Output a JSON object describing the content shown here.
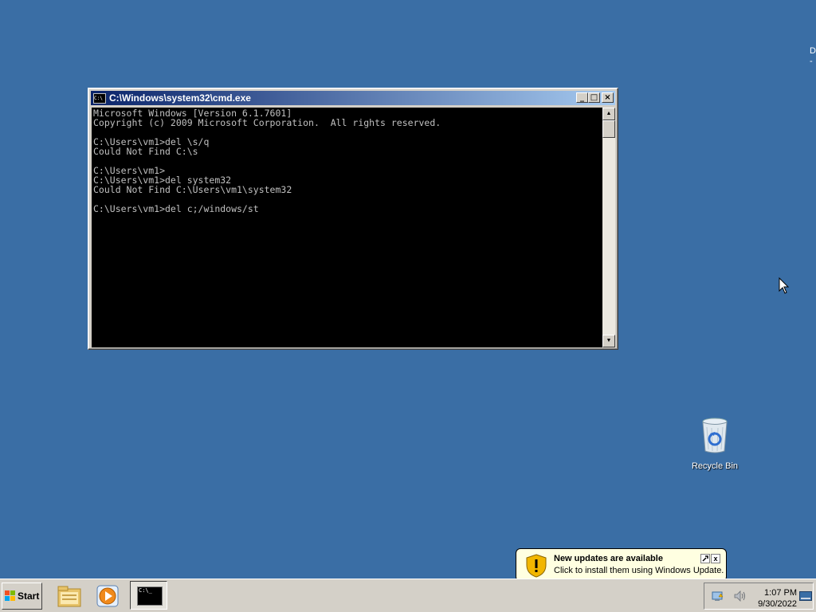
{
  "desktop": {
    "edge_text_1": "D",
    "edge_text_2": "-",
    "recycle_bin_label": "Recycle Bin"
  },
  "cmd_window": {
    "title": "C:\\Windows\\system32\\cmd.exe",
    "icon_text": "C:\\",
    "buttons": {
      "minimize": "_",
      "maximize": "□",
      "close": "×"
    },
    "lines": [
      "Microsoft Windows [Version 6.1.7601]",
      "Copyright (c) 2009 Microsoft Corporation.  All rights reserved.",
      "",
      "C:\\Users\\vm1>del \\s/q",
      "Could Not Find C:\\s",
      "",
      "C:\\Users\\vm1>",
      "C:\\Users\\vm1>del system32",
      "Could Not Find C:\\Users\\vm1\\system32",
      "",
      "C:\\Users\\vm1>del c;/windows/st"
    ]
  },
  "notification": {
    "title": "New updates are available",
    "text": "Click to install them using Windows Update.",
    "close": "x"
  },
  "taskbar": {
    "start_label": "Start",
    "cmd_icon_text": "C:\\_",
    "clock_time": "1:07 PM",
    "clock_date": "9/30/2022"
  },
  "colors": {
    "desktop": "#3a6ea5",
    "title_gradient_start": "#0a246a",
    "title_gradient_end": "#a6caf0",
    "console_bg": "#000000",
    "console_text": "#c0c0c0",
    "balloon_bg": "#ffffe1"
  }
}
